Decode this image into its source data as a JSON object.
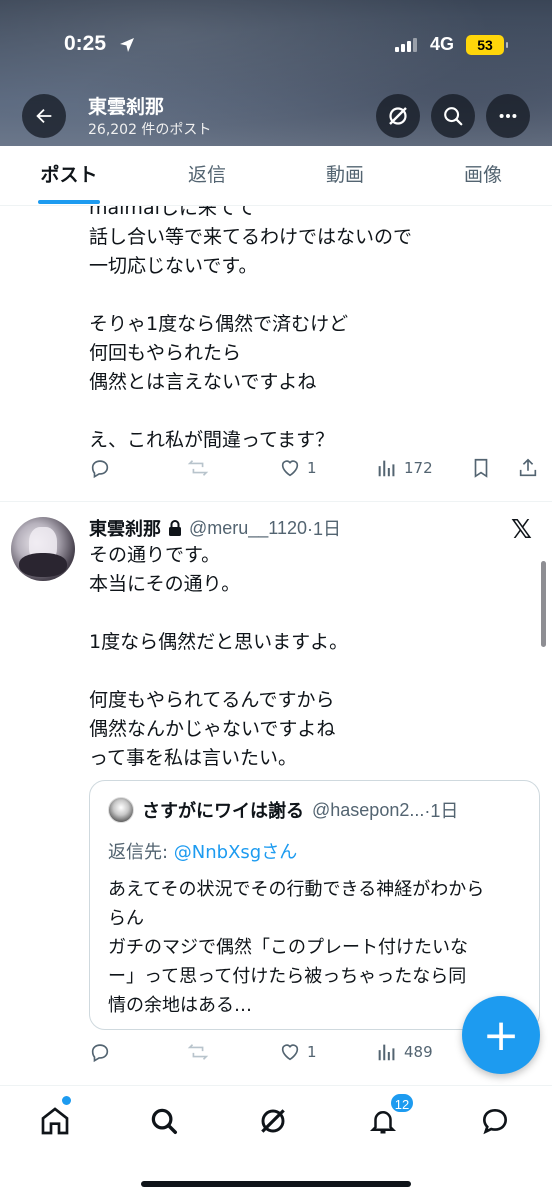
{
  "status_bar": {
    "time": "0:25",
    "network": "4G",
    "battery": "53"
  },
  "header": {
    "title": "東雲刹那",
    "post_count": "26,202 件のポスト"
  },
  "tabs": [
    {
      "label": "ポスト",
      "active": true
    },
    {
      "label": "返信",
      "active": false
    },
    {
      "label": "動画",
      "active": false
    },
    {
      "label": "画像",
      "active": false
    }
  ],
  "tweet1": {
    "text": "maimaiしに来てて\n話し合い等で来てるわけではないので\n一切応じないです。\n\nそりゃ1度なら偶然で済むけど\n何回もやられたら\n偶然とは言えないですよね\n\nえ、これ私が間違ってます？",
    "likes": "1",
    "views": "172"
  },
  "tweet2": {
    "name": "東雲刹那",
    "handle": "@meru__1120",
    "time": "·1日",
    "text": "その通りです。\n本当にその通り。\n\n1度なら偶然だと思いますよ。\n\n何度もやられてるんですから\n偶然なんかじゃないですよね\nって事を私は言いたい。",
    "quote": {
      "name": "さすがにワイは謝る",
      "handle": "@hasepon2...",
      "time": "·1日",
      "reply_prefix": "返信先: ",
      "reply_mention": "@NnbXsgさん",
      "text": "あえてその状況でその行動できる神経がわから\nらん\nガチのマジで偶然「このプレート付けたいな\nー」って思って付けたら被っちゃったなら同\n情の余地はある…"
    },
    "likes": "1",
    "views": "489"
  },
  "fab": {
    "label": "+"
  },
  "nav": {
    "notifications_badge": "12"
  },
  "colors": {
    "accent": "#1d9bf0",
    "text": "#0f1419",
    "secondary": "#536471"
  }
}
